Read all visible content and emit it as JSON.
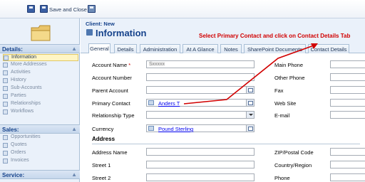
{
  "toolbar": {
    "save_label": "",
    "save_and_close_label": "Save and Close"
  },
  "header": {
    "entity_label": "Client: New",
    "title": "Information"
  },
  "annotation": {
    "text": "Select Primary Contact and click on Contact Details Tab",
    "color": "#d10000"
  },
  "tabs": [
    {
      "label": "General",
      "active": true
    },
    {
      "label": "Details"
    },
    {
      "label": "Administration"
    },
    {
      "label": "At A Glance"
    },
    {
      "label": "Notes"
    },
    {
      "label": "SharePoint Documents"
    },
    {
      "label": "Contact Details"
    }
  ],
  "nav": {
    "details_header": "Details:",
    "details_items": [
      "Information",
      "More Addresses",
      "Activities",
      "History",
      "Sub-Accounts",
      "Parties",
      "Relationships",
      "Workflows"
    ],
    "sales_header": "Sales:",
    "sales_items": [
      "Opportunities",
      "Quotes",
      "Orders",
      "Invoices"
    ],
    "service_header": "Service:"
  },
  "form": {
    "left_labels": {
      "account_name": "Account Name",
      "account_number": "Account Number",
      "parent_account": "Parent Account",
      "primary_contact": "Primary Contact",
      "relationship_type": "Relationship Type",
      "currency": "Currency"
    },
    "required_mark": "*",
    "account_name_value": "Sxxxxx",
    "primary_contact_value": "Anders T",
    "currency_value": "Pound Sterling",
    "right_labels": {
      "main_phone": "Main Phone",
      "other_phone": "Other Phone",
      "fax": "Fax",
      "web_site": "Web Site",
      "email": "E-mail"
    },
    "address_section": "Address",
    "address_labels": {
      "address_name": "Address Name",
      "street1": "Street 1",
      "street2": "Street 2",
      "zip": "ZIP/Postal Code",
      "country": "Country/Region",
      "phone": "Phone"
    }
  }
}
